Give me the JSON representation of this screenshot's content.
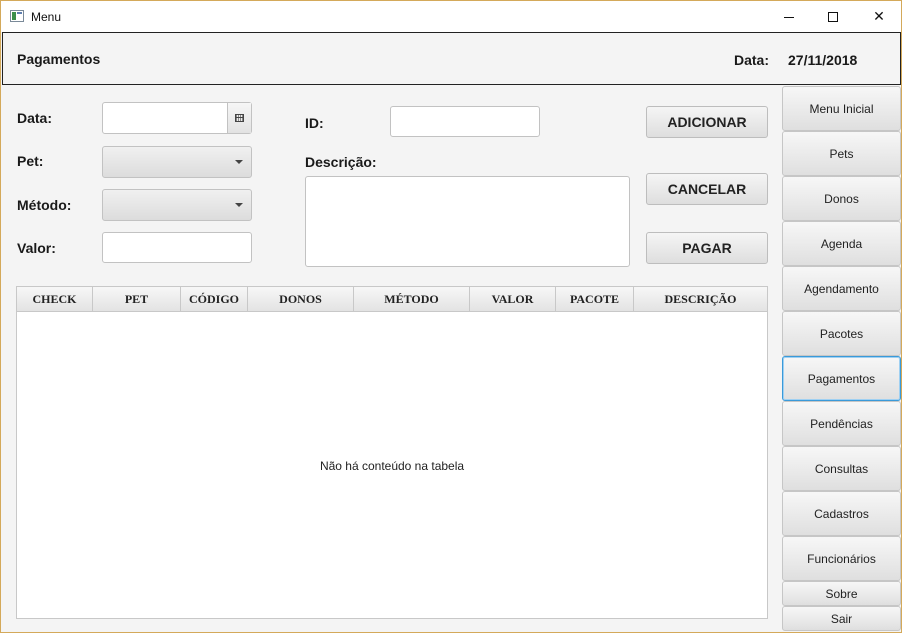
{
  "window": {
    "title": "Menu"
  },
  "header": {
    "title": "Pagamentos",
    "date_label": "Data:",
    "date_value": "27/11/2018"
  },
  "form": {
    "data_label": "Data:",
    "pet_label": "Pet:",
    "metodo_label": "Método:",
    "valor_label": "Valor:",
    "id_label": "ID:",
    "descricao_label": "Descrição:",
    "data_value": "",
    "valor_value": "",
    "id_value": "",
    "descricao_value": ""
  },
  "actions": {
    "adicionar": "ADICIONAR",
    "cancelar": "CANCELAR",
    "pagar": "PAGAR"
  },
  "table": {
    "columns": [
      "CHECK",
      "PET",
      "CÓDIGO",
      "DONOS",
      "MÉTODO",
      "VALOR",
      "PACOTE",
      "DESCRIÇÃO"
    ],
    "empty_message": "Não há conteúdo na tabela"
  },
  "sidebar": {
    "items": [
      {
        "label": "Menu Inicial"
      },
      {
        "label": "Pets"
      },
      {
        "label": "Donos"
      },
      {
        "label": "Agenda"
      },
      {
        "label": "Agendamento"
      },
      {
        "label": "Pacotes"
      },
      {
        "label": "Pagamentos"
      },
      {
        "label": "Pendências"
      },
      {
        "label": "Consultas"
      },
      {
        "label": "Cadastros"
      },
      {
        "label": "Funcionários"
      },
      {
        "label": "Sobre"
      },
      {
        "label": "Sair"
      }
    ],
    "active": "Pagamentos"
  },
  "colors": {
    "accent": "#3a9ad9",
    "window_border": "#d4a95a"
  }
}
